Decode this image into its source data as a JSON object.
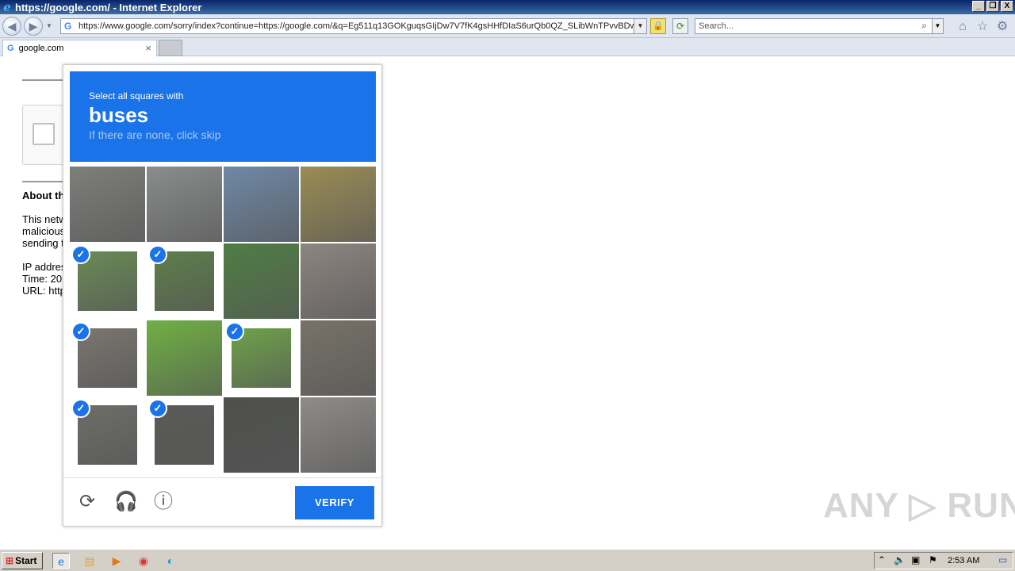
{
  "window": {
    "title": "https://google.com/ - Internet Explorer",
    "controls": [
      "_",
      "❐",
      "X"
    ]
  },
  "nav": {
    "address": "https://www.google.com/sorry/index?continue=https://google.com/&q=Eg511q13GOKguqsGIjDw7V7fK4gsHHfDIaS6urQb0QZ_SLibWnTPvvBDwb",
    "search_placeholder": "Search..."
  },
  "tabs": [
    {
      "label": "google.com"
    }
  ],
  "page": {
    "about_heading": "About th",
    "paragraph_lines": [
      "This netw",
      "malicious",
      "sending t"
    ],
    "info_lines": [
      "IP addres",
      "Time: 20",
      "URL: http"
    ]
  },
  "captcha": {
    "prompt_line1": "Select all squares with",
    "target": "buses",
    "hint": "If there are none, click skip",
    "tiles": [
      {
        "row": 0,
        "col": 0,
        "selected": false,
        "color": "#7d7f7b"
      },
      {
        "row": 0,
        "col": 1,
        "selected": false,
        "color": "#8a8d8c"
      },
      {
        "row": 0,
        "col": 2,
        "selected": false,
        "color": "#6f88a6"
      },
      {
        "row": 0,
        "col": 3,
        "selected": false,
        "color": "#9a8c55"
      },
      {
        "row": 1,
        "col": 0,
        "selected": true,
        "color": "#6a8a56"
      },
      {
        "row": 1,
        "col": 1,
        "selected": true,
        "color": "#5d7e4a"
      },
      {
        "row": 1,
        "col": 2,
        "selected": false,
        "color": "#4f7d45"
      },
      {
        "row": 1,
        "col": 3,
        "selected": false,
        "color": "#8d8580"
      },
      {
        "row": 2,
        "col": 0,
        "selected": true,
        "color": "#7a7670"
      },
      {
        "row": 2,
        "col": 1,
        "selected": false,
        "color": "#6fb044"
      },
      {
        "row": 2,
        "col": 2,
        "selected": true,
        "color": "#6ea24a"
      },
      {
        "row": 2,
        "col": 3,
        "selected": false,
        "color": "#777269"
      },
      {
        "row": 3,
        "col": 0,
        "selected": true,
        "color": "#6e6d68"
      },
      {
        "row": 3,
        "col": 1,
        "selected": true,
        "color": "#5a5b58"
      },
      {
        "row": 3,
        "col": 2,
        "selected": false,
        "color": "#4e504d"
      },
      {
        "row": 3,
        "col": 3,
        "selected": false,
        "color": "#8e8c88"
      }
    ],
    "verify_label": "VERIFY"
  },
  "watermark": "ANY ▷ RUN",
  "taskbar": {
    "start_label": "Start",
    "clock": "2:53 AM"
  },
  "colors": {
    "accent": "#1a73e8"
  }
}
